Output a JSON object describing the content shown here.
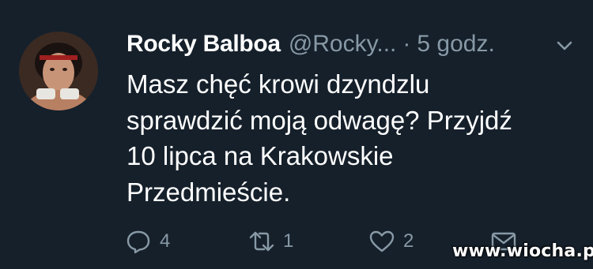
{
  "tweet": {
    "name": "Rocky Balboa",
    "handle": "@Rocky...",
    "separator": "·",
    "time": "5 godz.",
    "text_lines": [
      "Masz chęć krowi dzyndzlu",
      "sprawdzić moją odwagę? Przyjdź",
      "10 lipca na Krakowskie",
      "Przedmieście."
    ]
  },
  "actions": {
    "reply_count": "4",
    "retweet_count": "1",
    "like_count": "2"
  },
  "icons": {
    "reply": "speech-bubble-icon",
    "retweet": "retweet-icon",
    "like": "heart-icon",
    "dm": "envelope-icon",
    "more": "chevron-down-icon"
  },
  "watermark": "www.wiocha.pl",
  "colors": {
    "background": "#15202b",
    "text": "#ffffff",
    "secondary": "#8899a6"
  }
}
